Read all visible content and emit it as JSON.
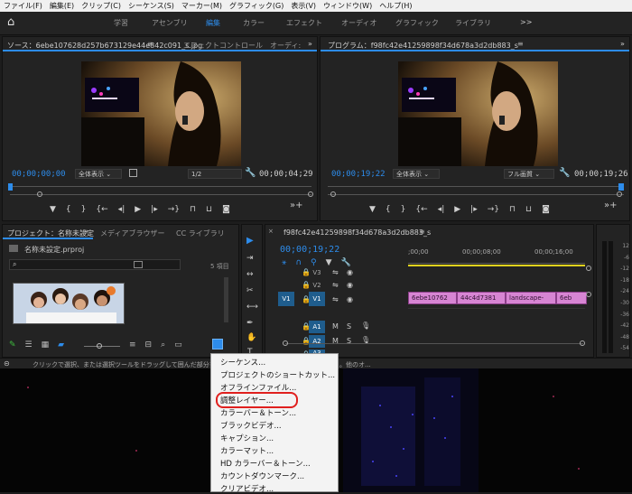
{
  "menubar": [
    "ファイル(F)",
    "編集(E)",
    "クリップ(C)",
    "シーケンス(S)",
    "マーカー(M)",
    "グラフィック(G)",
    "表示(V)",
    "ウィンドウ(W)",
    "ヘルプ(H)"
  ],
  "workspaces": {
    "items": [
      "学習",
      "アセンブリ",
      "編集",
      "カラー",
      "エフェクト",
      "オーディオ",
      "グラフィック",
      "ライブラリ"
    ],
    "active": "編集",
    "more": ">>"
  },
  "source": {
    "tab_source": "ソース：6ebe107628d257b673129e44e842c091_s.jpg",
    "tab_effects": "エフェクトコントロール",
    "tab_audio": "オーディ:",
    "timecode_left": "00;00;00;00",
    "zoom": "全体表示",
    "resolution": "1/2",
    "timecode_right": "00;00;04;29"
  },
  "program": {
    "title": "プログラム：f98fc42e41259898f34d678a3d2db883_s",
    "timecode_left": "00;00;19;22",
    "zoom": "全体表示",
    "quality": "フル画質",
    "timecode_right": "00;00;19;26"
  },
  "project": {
    "tab_project": "プロジェクト：名称未設定",
    "tab_media": "メディアブラウザー",
    "tab_cc": "CC ライブラリ",
    "file": "名称未設定.prproj",
    "search_placeholder": "",
    "item_count": "5 項目"
  },
  "timeline": {
    "title": "f98fc42e41259898f34d678a3d2db883_s",
    "timecode": "00;00;19;22",
    "ruler": [
      ";00;00",
      "00;00;08;00",
      "00;00;16;00"
    ],
    "video_tracks": [
      "V3",
      "V2",
      "V1"
    ],
    "audio_tracks": [
      "A1",
      "A2",
      "A3"
    ],
    "track_src": "V1",
    "clips": [
      "6ebe10762",
      "44c4d7381",
      "landscape-",
      "6eb"
    ],
    "mute": "M",
    "solo": "S"
  },
  "meter": {
    "labels": [
      "12",
      "-6",
      "-12",
      "-18",
      "-24",
      "-30",
      "-36",
      "-42",
      "-48",
      "-54"
    ]
  },
  "status": {
    "text": "クリックで選択、または選択ツールをドラッグして囲んだ部分を選",
    "tail": "。他のオ..."
  },
  "new_item_menu": [
    "シーケンス...",
    "プロジェクトのショートカット...",
    "オフラインファイル...",
    "調整レイヤー...",
    "カラーバー＆トーン...",
    "ブラックビデオ...",
    "キャプション...",
    "カラーマット...",
    "HD カラーバー＆トーン...",
    "カウントダウンマーク...",
    "クリアビデオ..."
  ],
  "highlighted_item": "調整レイヤー...",
  "colors": {
    "accent": "#2d8ceb",
    "clip": "#d785d3",
    "highlight_ring": "#e0201e",
    "track_v1": "#1f5d8d"
  }
}
